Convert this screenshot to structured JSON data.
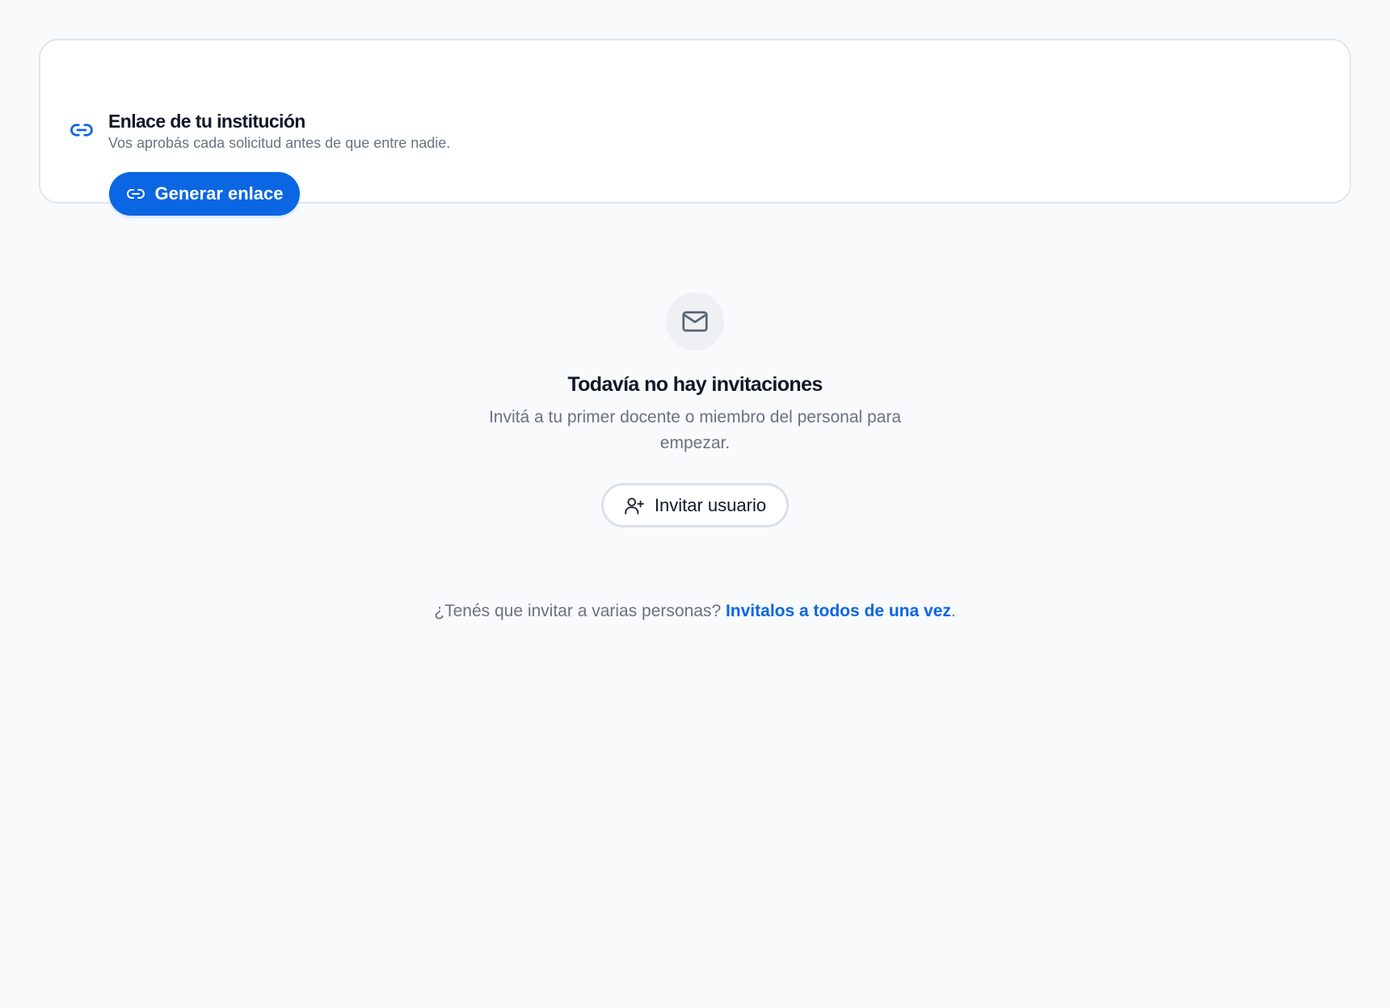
{
  "link_card": {
    "icon": "link-icon",
    "title": "Enlace de tu institución",
    "subtitle": "Vos aprobás cada solicitud antes de que entre nadie.",
    "generate_button": {
      "icon": "link-icon",
      "label": "Generar enlace"
    }
  },
  "empty_state": {
    "icon": "mail-icon",
    "title": "Todavía no hay invitaciones",
    "description": "Invitá a tu primer docente o miembro del personal para empezar.",
    "invite_button": {
      "icon": "user-plus-icon",
      "label": "Invitar usuario"
    }
  },
  "bulk_invite": {
    "prompt": "¿Tenés que invitar a varias personas?",
    "link_label": "Invitalos a todos de una vez",
    "suffix": "."
  },
  "colors": {
    "accent": "#0b66e4",
    "background": "#f8fafc",
    "muted_text": "#6b7280"
  }
}
